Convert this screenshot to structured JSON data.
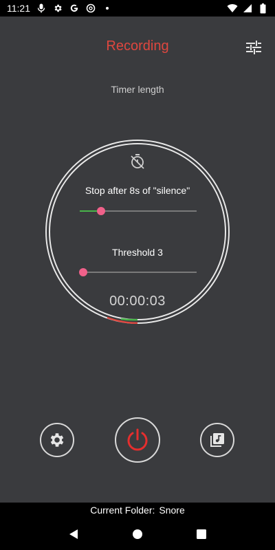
{
  "status_bar": {
    "time": "11:21",
    "icons": [
      "microphone-icon",
      "gear-icon",
      "google-icon",
      "at-sign-icon",
      "dot-icon",
      "wifi-icon",
      "signal-icon",
      "battery-icon"
    ]
  },
  "header": {
    "title": "Recording",
    "filter_icon": "tune-icon"
  },
  "timer": {
    "label": "Timer length",
    "icon": "timer-off-icon"
  },
  "silence_slider": {
    "label": "Stop after 8s of \"silence\"",
    "value_fraction": 0.18
  },
  "threshold_slider": {
    "label": "Threshold 3",
    "value_fraction": 0.03
  },
  "elapsed": "00:00:03",
  "controls": {
    "settings_icon": "gear-icon",
    "power_icon": "power-icon",
    "library_icon": "music-library-icon"
  },
  "footer": {
    "folder_label": "Current Folder:",
    "folder_name": "Snore"
  },
  "colors": {
    "accent_red": "#e0473f",
    "power_red": "#e52e2e",
    "slider_green": "#49b54a",
    "thumb_pink": "#f0618a",
    "background": "#3a3b3e"
  }
}
